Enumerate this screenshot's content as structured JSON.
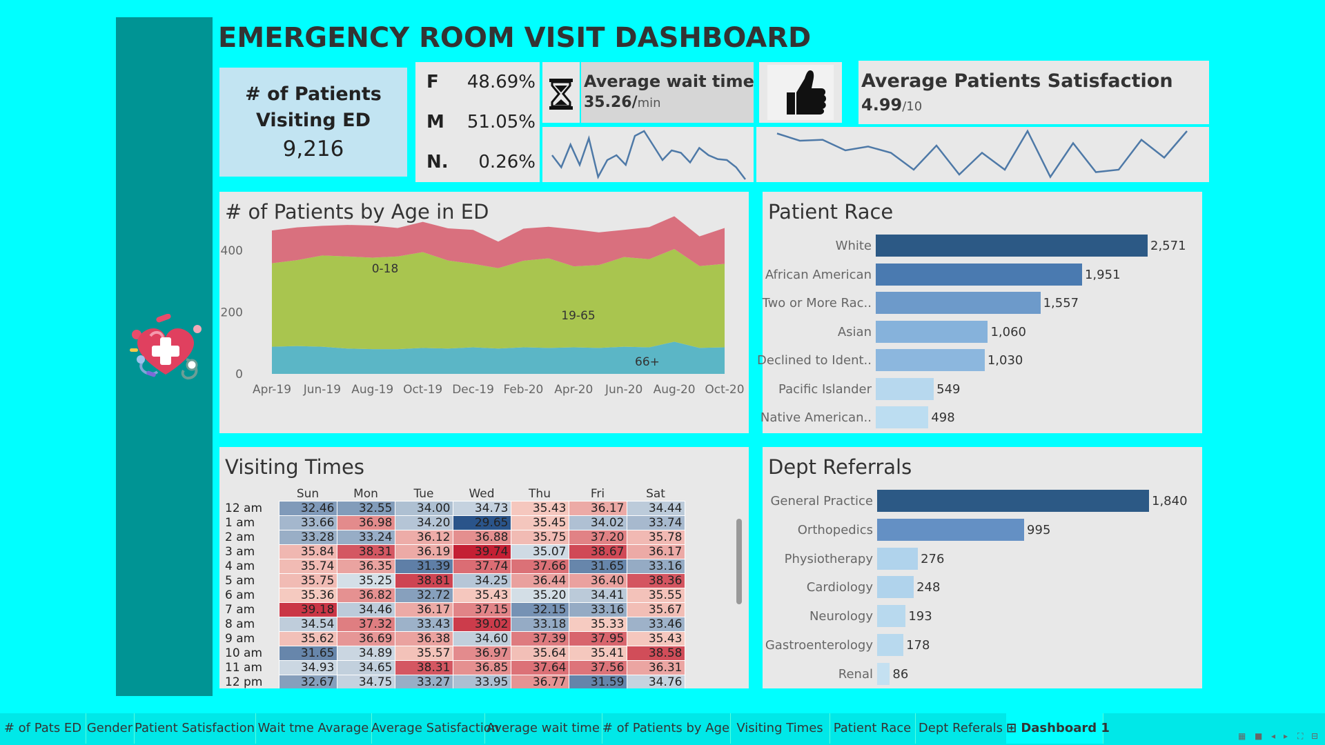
{
  "title": "EMERGENCY ROOM VISIT DASHBOARD",
  "kpi_patients": {
    "label_line1": "# of Patients",
    "label_line2": "Visiting ED",
    "value": "9,216"
  },
  "gender": [
    {
      "key": "F",
      "value": "48.69%"
    },
    {
      "key": "M",
      "value": "51.05%"
    },
    {
      "key": "N.",
      "value": "0.26%"
    }
  ],
  "wait": {
    "label": "Average wait time",
    "value": "35.26/",
    "unit": "min",
    "icon": "hourglass-icon",
    "spark": [
      0.5,
      0.25,
      0.72,
      0.3,
      0.85,
      0.05,
      0.4,
      0.5,
      0.3,
      0.9,
      1.0,
      0.7,
      0.4,
      0.6,
      0.55,
      0.35,
      0.65,
      0.5,
      0.42,
      0.4,
      0.25,
      0.0
    ]
  },
  "satisfaction": {
    "label": "Average Patients Satisfaction",
    "value": "4.99",
    "unit": "/10",
    "icon": "thumbs-up-icon",
    "spark": [
      0.95,
      0.8,
      0.82,
      0.6,
      0.68,
      0.55,
      0.2,
      0.7,
      0.1,
      0.55,
      0.2,
      1.0,
      0.05,
      0.75,
      0.15,
      0.2,
      0.82,
      0.45,
      1.0
    ]
  },
  "age_chart": {
    "title": "# of Patients by Age in ED",
    "chart_data": {
      "type": "area",
      "x": [
        "Apr-19",
        "Jun-19",
        "Aug-19",
        "Oct-19",
        "Dec-19",
        "Feb-20",
        "Apr-20",
        "Jun-20",
        "Aug-20",
        "Oct-20"
      ],
      "x_label_positions": [
        0,
        2,
        4,
        6,
        8,
        10,
        12,
        14,
        16,
        18
      ],
      "ylim": [
        0,
        500
      ],
      "yticks": [
        0,
        200,
        400
      ],
      "series": [
        {
          "name": "66+",
          "values": [
            88,
            90,
            88,
            82,
            80,
            80,
            84,
            82,
            86,
            82,
            86,
            84,
            86,
            84,
            88,
            86,
            104,
            84,
            86
          ],
          "color": "#5BB6C6"
        },
        {
          "name": "19-65",
          "values": [
            270,
            278,
            295,
            298,
            296,
            300,
            310,
            285,
            270,
            260,
            280,
            290,
            262,
            268,
            290,
            285,
            300,
            265,
            270
          ],
          "color": "#A9C54F"
        },
        {
          "name": "0-18",
          "values": [
            106,
            106,
            96,
            102,
            104,
            92,
            98,
            104,
            110,
            86,
            104,
            102,
            120,
            106,
            88,
            104,
            106,
            96,
            116
          ],
          "color": "#D9707E"
        }
      ]
    }
  },
  "race_chart": {
    "title": "Patient Race",
    "chart_data": {
      "type": "bar",
      "categories": [
        "White",
        "African American",
        "Two or More Rac..",
        "Asian",
        "Declined to Ident..",
        "Pacific Islander",
        "Native American.."
      ],
      "values": [
        2571,
        1951,
        1557,
        1060,
        1030,
        549,
        498
      ],
      "value_labels": [
        "2,571",
        "1,951",
        "1,557",
        "1,060",
        "1,030",
        "549",
        "498"
      ],
      "colors": [
        "#2C5985",
        "#4A7AB0",
        "#6D9ACA",
        "#86B2DB",
        "#8CB7DE",
        "#B7D8EE",
        "#BCDDF1"
      ]
    }
  },
  "dept_chart": {
    "title": "Dept Referrals",
    "chart_data": {
      "type": "bar",
      "categories": [
        "General Practice",
        "Orthopedics",
        "Physiotherapy",
        "Cardiology",
        "Neurology",
        "Gastroenterology",
        "Renal"
      ],
      "values": [
        1840,
        995,
        276,
        248,
        193,
        178,
        86
      ],
      "value_labels": [
        "1,840",
        "995",
        "276",
        "248",
        "193",
        "178",
        "86"
      ],
      "colors": [
        "#2C5985",
        "#6490C4",
        "#B0D3EC",
        "#B0D3EC",
        "#B8D9EE",
        "#B8D9EE",
        "#C4E0F1"
      ]
    }
  },
  "visiting_times": {
    "title": "Visiting Times",
    "chart_data": {
      "type": "heatmap",
      "columns": [
        "Sun",
        "Mon",
        "Tue",
        "Wed",
        "Thu",
        "Fri",
        "Sat"
      ],
      "rows": [
        "12 am",
        "1 am",
        "2 am",
        "3 am",
        "4 am",
        "5 am",
        "6 am",
        "7 am",
        "8 am",
        "9 am",
        "10 am",
        "11 am",
        "12 pm"
      ],
      "values": [
        [
          32.46,
          32.55,
          34.0,
          34.73,
          35.43,
          36.17,
          34.44
        ],
        [
          33.66,
          36.98,
          34.2,
          29.65,
          35.45,
          34.02,
          33.74
        ],
        [
          33.28,
          33.24,
          36.12,
          36.88,
          35.75,
          37.2,
          35.78
        ],
        [
          35.84,
          38.31,
          36.19,
          39.74,
          35.07,
          38.67,
          36.17
        ],
        [
          35.74,
          36.35,
          31.39,
          37.74,
          37.66,
          31.65,
          33.16
        ],
        [
          35.75,
          35.25,
          38.81,
          34.25,
          36.44,
          36.4,
          38.36
        ],
        [
          35.36,
          36.82,
          32.72,
          35.43,
          35.2,
          34.41,
          35.55
        ],
        [
          39.18,
          34.46,
          36.17,
          37.15,
          32.15,
          33.16,
          35.67
        ],
        [
          34.54,
          37.32,
          33.43,
          39.02,
          33.18,
          35.33,
          33.46
        ],
        [
          35.62,
          36.69,
          36.38,
          34.6,
          37.39,
          37.95,
          35.43
        ],
        [
          31.65,
          34.89,
          35.57,
          36.97,
          35.64,
          35.41,
          38.58
        ],
        [
          34.93,
          34.65,
          38.31,
          36.85,
          37.64,
          37.56,
          36.31
        ],
        [
          32.67,
          34.75,
          33.27,
          33.95,
          36.77,
          31.59,
          34.76
        ]
      ],
      "range": [
        29.65,
        39.74
      ]
    }
  },
  "tabs": [
    "# of Pats ED",
    "Gender",
    "Patient Satisfaction",
    "Wait tme Avarage",
    "Average Satisfaction",
    "Average wait time",
    "# of Patients by Age",
    "Visiting Times",
    "Patient Race",
    "Dept Referals",
    "Dashboard 1"
  ],
  "active_tab": "Dashboard 1"
}
